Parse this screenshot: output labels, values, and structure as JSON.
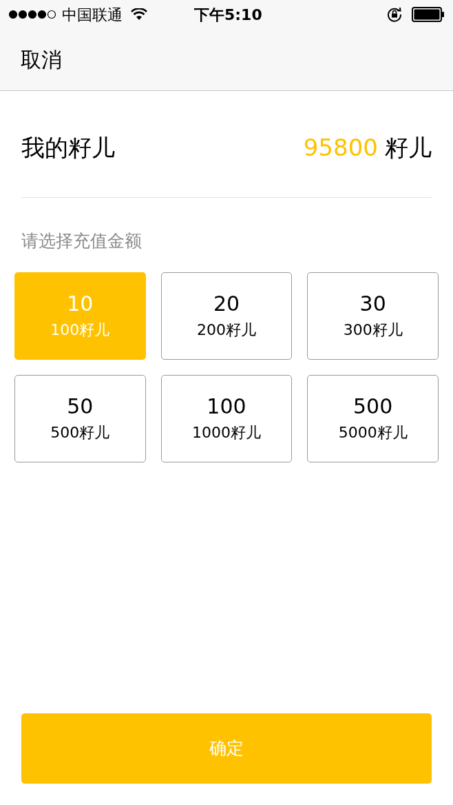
{
  "status_bar": {
    "carrier": "中国联通",
    "time": "下午5:10"
  },
  "nav": {
    "cancel": "取消"
  },
  "balance": {
    "label": "我的籽儿",
    "amount": "95800",
    "unit": "籽儿"
  },
  "prompt": "请选择充值金额",
  "options": [
    {
      "price": "10",
      "seeds": "100籽儿",
      "selected": true
    },
    {
      "price": "20",
      "seeds": "200籽儿",
      "selected": false
    },
    {
      "price": "30",
      "seeds": "300籽儿",
      "selected": false
    },
    {
      "price": "50",
      "seeds": "500籽儿",
      "selected": false
    },
    {
      "price": "100",
      "seeds": "1000籽儿",
      "selected": false
    },
    {
      "price": "500",
      "seeds": "5000籽儿",
      "selected": false
    }
  ],
  "confirm": "确定"
}
